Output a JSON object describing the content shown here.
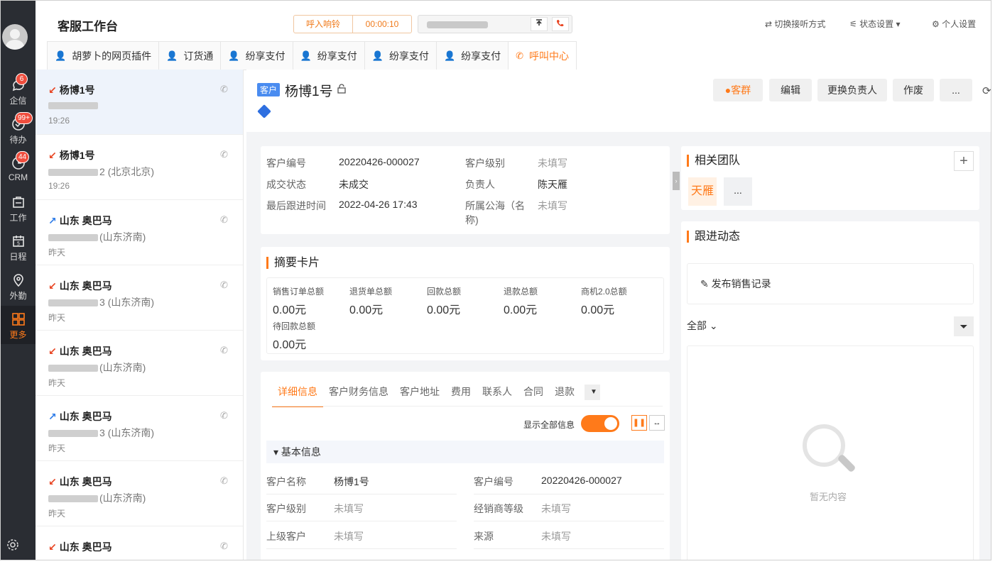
{
  "nav": {
    "items": [
      {
        "label": "企信",
        "badge": "6",
        "icon": "chat-bubble-icon"
      },
      {
        "label": "待办",
        "badge": "99+",
        "icon": "check-circle-icon"
      },
      {
        "label": "CRM",
        "badge": "44",
        "icon": "crm-icon"
      },
      {
        "label": "工作",
        "badge": "",
        "icon": "work-icon"
      },
      {
        "label": "日程",
        "badge": "",
        "icon": "calendar-icon",
        "day": "5"
      },
      {
        "label": "外勤",
        "badge": "",
        "icon": "location-pin-icon"
      },
      {
        "label": "更多",
        "badge": "",
        "icon": "grid-icon"
      }
    ]
  },
  "header": {
    "title": "客服工作台",
    "call_status": "呼入响铃",
    "call_timer": "00:00:10",
    "switch_listen": "切换接听方式",
    "status_settings": "状态设置",
    "personal_settings": "个人设置"
  },
  "tabs": [
    {
      "label": "胡萝卜的网页插件",
      "active": false
    },
    {
      "label": "订货通",
      "active": false
    },
    {
      "label": "纷享支付",
      "active": false
    },
    {
      "label": "纷享支付",
      "active": false
    },
    {
      "label": "纷享支付",
      "active": false
    },
    {
      "label": "纷享支付",
      "active": false
    },
    {
      "label": "呼叫中心",
      "active": true
    }
  ],
  "contacts": [
    {
      "name": "杨博1号",
      "direction": "in",
      "number_visible": "",
      "location": "",
      "time": "19:26",
      "selected": true
    },
    {
      "name": "杨博1号",
      "direction": "in",
      "number_visible": "2",
      "location": "(北京北京)",
      "time": "19:26",
      "selected": false
    },
    {
      "name": "山东 奥巴马",
      "direction": "out",
      "number_visible": "",
      "location": "(山东济南)",
      "time": "昨天",
      "selected": false
    },
    {
      "name": "山东 奥巴马",
      "direction": "in",
      "number_visible": "3",
      "location": "(山东济南)",
      "time": "昨天",
      "selected": false
    },
    {
      "name": "山东 奥巴马",
      "direction": "in",
      "number_visible": "",
      "location": "(山东济南)",
      "time": "昨天",
      "selected": false
    },
    {
      "name": "山东 奥巴马",
      "direction": "out",
      "number_visible": "3",
      "location": "(山东济南)",
      "time": "昨天",
      "selected": false
    },
    {
      "name": "山东 奥巴马",
      "direction": "in",
      "number_visible": "",
      "location": "(山东济南)",
      "time": "昨天",
      "selected": false
    },
    {
      "name": "山东 奥巴马",
      "direction": "in",
      "number_visible": "",
      "location": "",
      "time": "",
      "selected": false
    }
  ],
  "customer": {
    "tag": "客户",
    "name": "杨博1号",
    "actions": {
      "group": "客群",
      "edit": "编辑",
      "change_owner": "更换负责人",
      "void": "作废",
      "more": "..."
    }
  },
  "info": {
    "cust_no_label": "客户编号",
    "cust_no": "20220426-000027",
    "level_label": "客户级别",
    "level": "未填写",
    "deal_label": "成交状态",
    "deal": "未成交",
    "owner_label": "负责人",
    "owner": "陈天雁",
    "last_follow_label": "最后跟进时间",
    "last_follow": "2022-04-26 17:43",
    "pool_label": "所属公海（名称)",
    "pool": "未填写"
  },
  "summary": {
    "title": "摘要卡片",
    "items": [
      {
        "label": "销售订单总额",
        "value": "0.00元"
      },
      {
        "label": "退货单总额",
        "value": "0.00元"
      },
      {
        "label": "回款总额",
        "value": "0.00元"
      },
      {
        "label": "退款总额",
        "value": "0.00元"
      },
      {
        "label": "商机2.0总额",
        "value": "0.00元"
      },
      {
        "label": "待回款总额",
        "value": "0.00元"
      }
    ]
  },
  "detail": {
    "tabs": [
      "详细信息",
      "客户财务信息",
      "客户地址",
      "费用",
      "联系人",
      "合同",
      "退款"
    ],
    "show_all": "显示全部信息",
    "show_all_on": true,
    "basic_section": "基本信息",
    "fields": [
      {
        "label": "客户名称",
        "value": "杨博1号",
        "gray": false
      },
      {
        "label": "客户编号",
        "value": "20220426-000027",
        "gray": false
      },
      {
        "label": "客户级别",
        "value": "未填写",
        "gray": true
      },
      {
        "label": "经销商等级",
        "value": "未填写",
        "gray": true
      },
      {
        "label": "上级客户",
        "value": "未填写",
        "gray": true
      },
      {
        "label": "来源",
        "value": "未填写",
        "gray": true
      }
    ]
  },
  "team": {
    "title": "相关团队",
    "member": "天雁",
    "more": "..."
  },
  "follow": {
    "title": "跟进动态",
    "publish": "发布销售记录",
    "filter": "全部",
    "empty": "暂无内容"
  },
  "colors": {
    "accent": "#ff7a1a",
    "nav_bg": "#2a2d33",
    "badge": "#f04e3e",
    "tag_blue": "#4a8cf0"
  }
}
